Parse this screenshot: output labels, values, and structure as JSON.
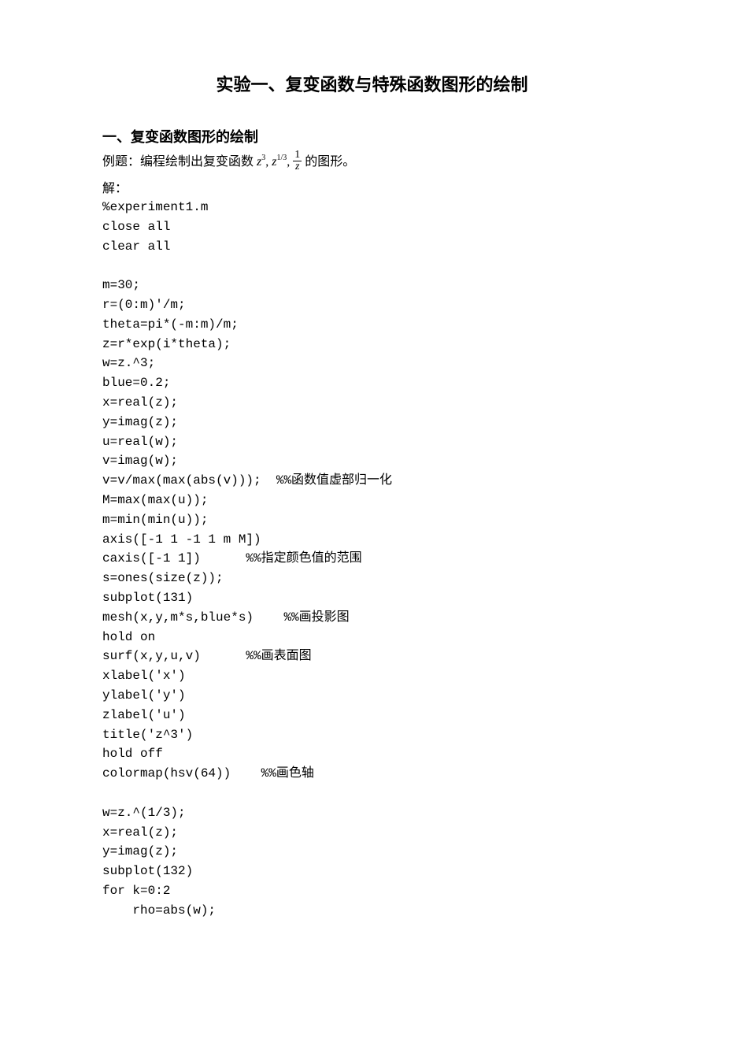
{
  "title": "实验一、复变函数与特殊函数图形的绘制",
  "section_heading": "一、复变函数图形的绘制",
  "example": {
    "prefix": "例题：编程绘制出复变函数",
    "z": "z",
    "exp1": "3",
    "comma1": ",",
    "exp2": "1/3",
    "comma2": ",",
    "frac_num": "1",
    "frac_den": "z",
    "suffix": "的图形。"
  },
  "solution_label": "解：",
  "code": "%experiment1.m\nclose all\nclear all\n\nm=30;\nr=(0:m)'/m;\ntheta=pi*(-m:m)/m;\nz=r*exp(i*theta);\nw=z.^3;\nblue=0.2;\nx=real(z);\ny=imag(z);\nu=real(w);\nv=imag(w);\nv=v/max(max(abs(v)));  %%函数值虚部归一化\nM=max(max(u));\nm=min(min(u));\naxis([-1 1 -1 1 m M])\ncaxis([-1 1])      %%指定颜色值的范围\ns=ones(size(z));\nsubplot(131)\nmesh(x,y,m*s,blue*s)    %%画投影图\nhold on\nsurf(x,y,u,v)      %%画表面图\nxlabel('x')\nylabel('y')\nzlabel('u')\ntitle('z^3')\nhold off\ncolormap(hsv(64))    %%画色轴\n\nw=z.^(1/3);\nx=real(z);\ny=imag(z);\nsubplot(132)\nfor k=0:2\n    rho=abs(w);"
}
